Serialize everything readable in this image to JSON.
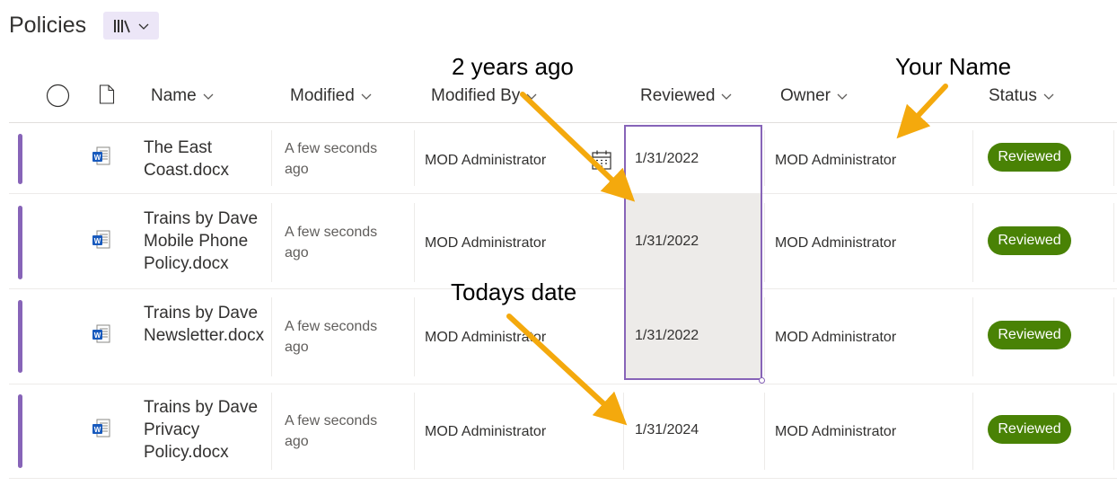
{
  "page": {
    "title": "Policies"
  },
  "view_switcher": {
    "icon": "library-icon"
  },
  "columns": {
    "name": "Name",
    "modified": "Modified",
    "modified_by": "Modified By",
    "reviewed": "Reviewed",
    "owner": "Owner",
    "status": "Status"
  },
  "rows": [
    {
      "name": "The East Coast.docx",
      "modified": "A few seconds ago",
      "modified_by": "MOD Administrator",
      "reviewed": "1/31/2022",
      "owner": "MOD Administrator",
      "status": "Reviewed"
    },
    {
      "name": "Trains by Dave Mobile Phone Policy.docx",
      "modified": "A few seconds ago",
      "modified_by": "MOD Administrator",
      "reviewed": "1/31/2022",
      "owner": "MOD Administrator",
      "status": "Reviewed"
    },
    {
      "name": "Trains by Dave Newsletter.docx",
      "modified": "A few seconds ago",
      "modified_by": "MOD Administrator",
      "reviewed": "1/31/2022",
      "owner": "MOD Administrator",
      "status": "Reviewed"
    },
    {
      "name": "Trains by Dave Privacy Policy.docx",
      "modified": "A few seconds ago",
      "modified_by": "MOD Administrator",
      "reviewed": "1/31/2024",
      "owner": "MOD Administrator",
      "status": "Reviewed"
    }
  ],
  "annotations": {
    "two_years_ago": "2 years ago",
    "your_name": "Your Name",
    "todays_date": "Todays date"
  },
  "colors": {
    "accent": "#8764b8",
    "status_green": "#498205",
    "annotation_arrow": "#f4a90d"
  }
}
